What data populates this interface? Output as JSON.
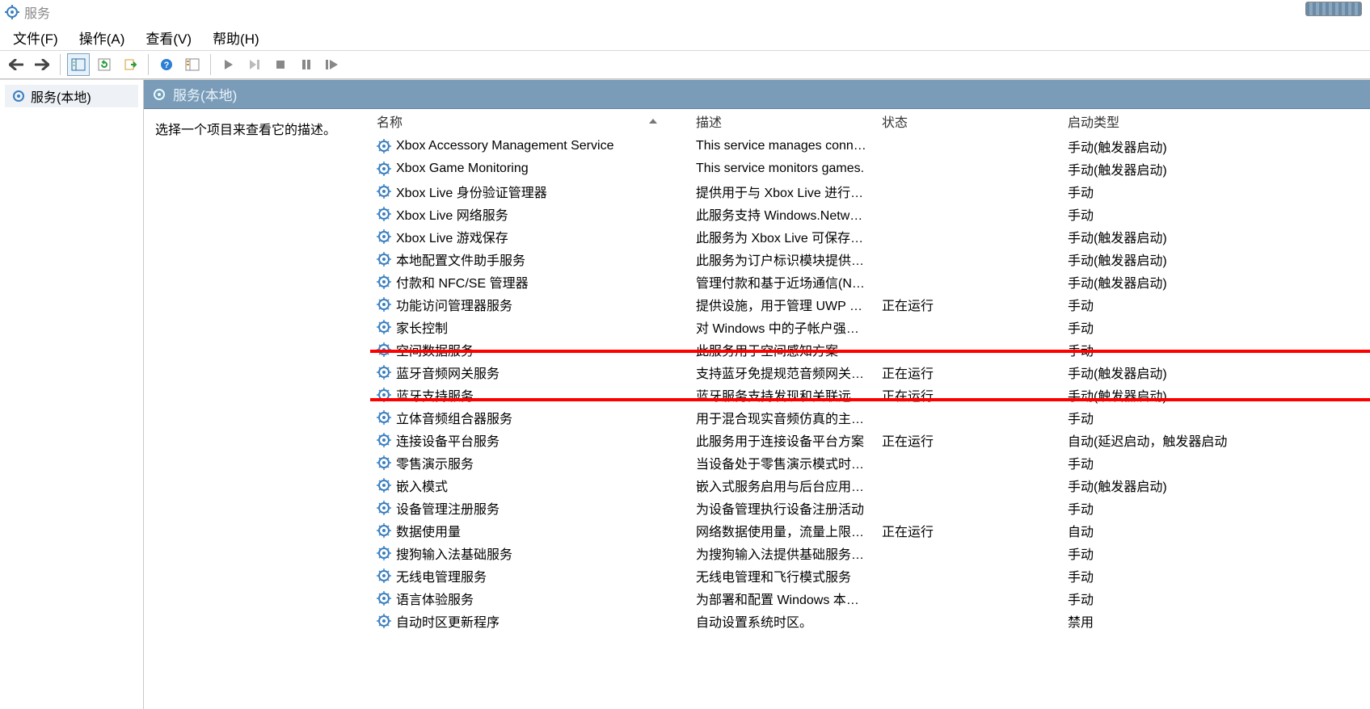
{
  "window": {
    "title": "服务"
  },
  "menu": {
    "file": "文件(F)",
    "action": "操作(A)",
    "view": "查看(V)",
    "help": "帮助(H)"
  },
  "tree": {
    "root": "服务(本地)"
  },
  "pane": {
    "title": "服务(本地)",
    "hint": "选择一个项目来查看它的描述。"
  },
  "columns": {
    "name": "名称",
    "desc": "描述",
    "status": "状态",
    "startup": "启动类型"
  },
  "highlight": {
    "start_index": 10,
    "end_index": 11
  },
  "services": [
    {
      "name": "Xbox Accessory Management Service",
      "desc": "This service manages conne...",
      "status": "",
      "startup": "手动(触发器启动)"
    },
    {
      "name": "Xbox Game Monitoring",
      "desc": "This service monitors games.",
      "status": "",
      "startup": "手动(触发器启动)"
    },
    {
      "name": "Xbox Live 身份验证管理器",
      "desc": "提供用于与 Xbox Live 进行交...",
      "status": "",
      "startup": "手动"
    },
    {
      "name": "Xbox Live 网络服务",
      "desc": "此服务支持 Windows.Networ...",
      "status": "",
      "startup": "手动"
    },
    {
      "name": "Xbox Live 游戏保存",
      "desc": "此服务为 Xbox Live 可保存游...",
      "status": "",
      "startup": "手动(触发器启动)"
    },
    {
      "name": "本地配置文件助手服务",
      "desc": "此服务为订户标识模块提供配...",
      "status": "",
      "startup": "手动(触发器启动)"
    },
    {
      "name": "付款和 NFC/SE 管理器",
      "desc": "管理付款和基于近场通信(NF...",
      "status": "",
      "startup": "手动(触发器启动)"
    },
    {
      "name": "功能访问管理器服务",
      "desc": "提供设施，用于管理 UWP 应...",
      "status": "正在运行",
      "startup": "手动"
    },
    {
      "name": "家长控制",
      "desc": "对 Windows 中的子帐户强制...",
      "status": "",
      "startup": "手动"
    },
    {
      "name": "空间数据服务",
      "desc": "此服务用于空间感知方案",
      "status": "",
      "startup": "手动"
    },
    {
      "name": "蓝牙音频网关服务",
      "desc": "支持蓝牙免提规范音频网关角...",
      "status": "正在运行",
      "startup": "手动(触发器启动)"
    },
    {
      "name": "蓝牙支持服务",
      "desc": "蓝牙服务支持发现和关联远程...",
      "status": "正在运行",
      "startup": "手动(触发器启动)"
    },
    {
      "name": "立体音频组合器服务",
      "desc": "用于混合现实音频仿真的主机...",
      "status": "",
      "startup": "手动"
    },
    {
      "name": "连接设备平台服务",
      "desc": "此服务用于连接设备平台方案",
      "status": "正在运行",
      "startup": "自动(延迟启动，触发器启动"
    },
    {
      "name": "零售演示服务",
      "desc": "当设备处于零售演示模式时，...",
      "status": "",
      "startup": "手动"
    },
    {
      "name": "嵌入模式",
      "desc": "嵌入式服务启用与后台应用程...",
      "status": "",
      "startup": "手动(触发器启动)"
    },
    {
      "name": "设备管理注册服务",
      "desc": "为设备管理执行设备注册活动",
      "status": "",
      "startup": "手动"
    },
    {
      "name": "数据使用量",
      "desc": "网络数据使用量，流量上限，...",
      "status": "正在运行",
      "startup": "自动"
    },
    {
      "name": "搜狗输入法基础服务",
      "desc": "为搜狗输入法提供基础服务，...",
      "status": "",
      "startup": "手动"
    },
    {
      "name": "无线电管理服务",
      "desc": "无线电管理和飞行模式服务",
      "status": "",
      "startup": "手动"
    },
    {
      "name": "语言体验服务",
      "desc": "为部署和配置 Windows 本地...",
      "status": "",
      "startup": "手动"
    },
    {
      "name": "自动时区更新程序",
      "desc": "自动设置系统时区。",
      "status": "",
      "startup": "禁用"
    }
  ]
}
